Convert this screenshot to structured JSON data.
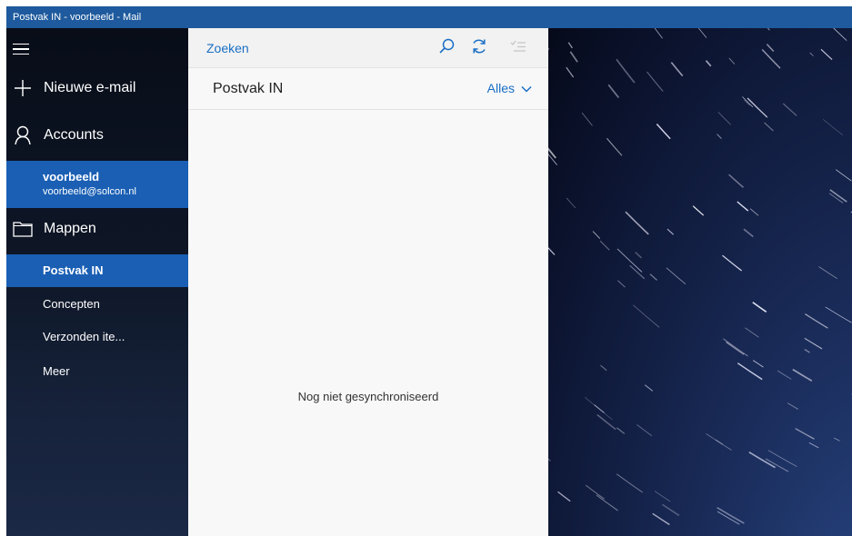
{
  "window": {
    "title": "Postvak IN - voorbeeld - Mail"
  },
  "sidebar": {
    "new_mail_label": "Nieuwe e-mail",
    "accounts_label": "Accounts",
    "account": {
      "name": "voorbeeld",
      "email": "voorbeeld@solcon.nl"
    },
    "folders_label": "Mappen",
    "folders": [
      {
        "label": "Postvak IN",
        "selected": true
      },
      {
        "label": "Concepten",
        "selected": false
      },
      {
        "label": "Verzonden ite...",
        "selected": false
      },
      {
        "label": "Meer",
        "selected": false
      }
    ]
  },
  "list": {
    "search_placeholder": "Zoeken",
    "folder_title": "Postvak IN",
    "filter_label": "Alles",
    "empty_message": "Nog niet gesynchroniseerd"
  },
  "icons": {
    "menu": "hamburger-menu-icon",
    "new_mail": "plus-icon",
    "accounts": "person-icon",
    "folders": "folder-icon",
    "search": "search-icon",
    "sync": "sync-icon",
    "select": "selection-mode-icon",
    "filter": "chevron-down-icon"
  },
  "colors": {
    "titlebar": "#1e5a9d",
    "accent": "#1a5fb4",
    "link": "#1a6fc4"
  }
}
